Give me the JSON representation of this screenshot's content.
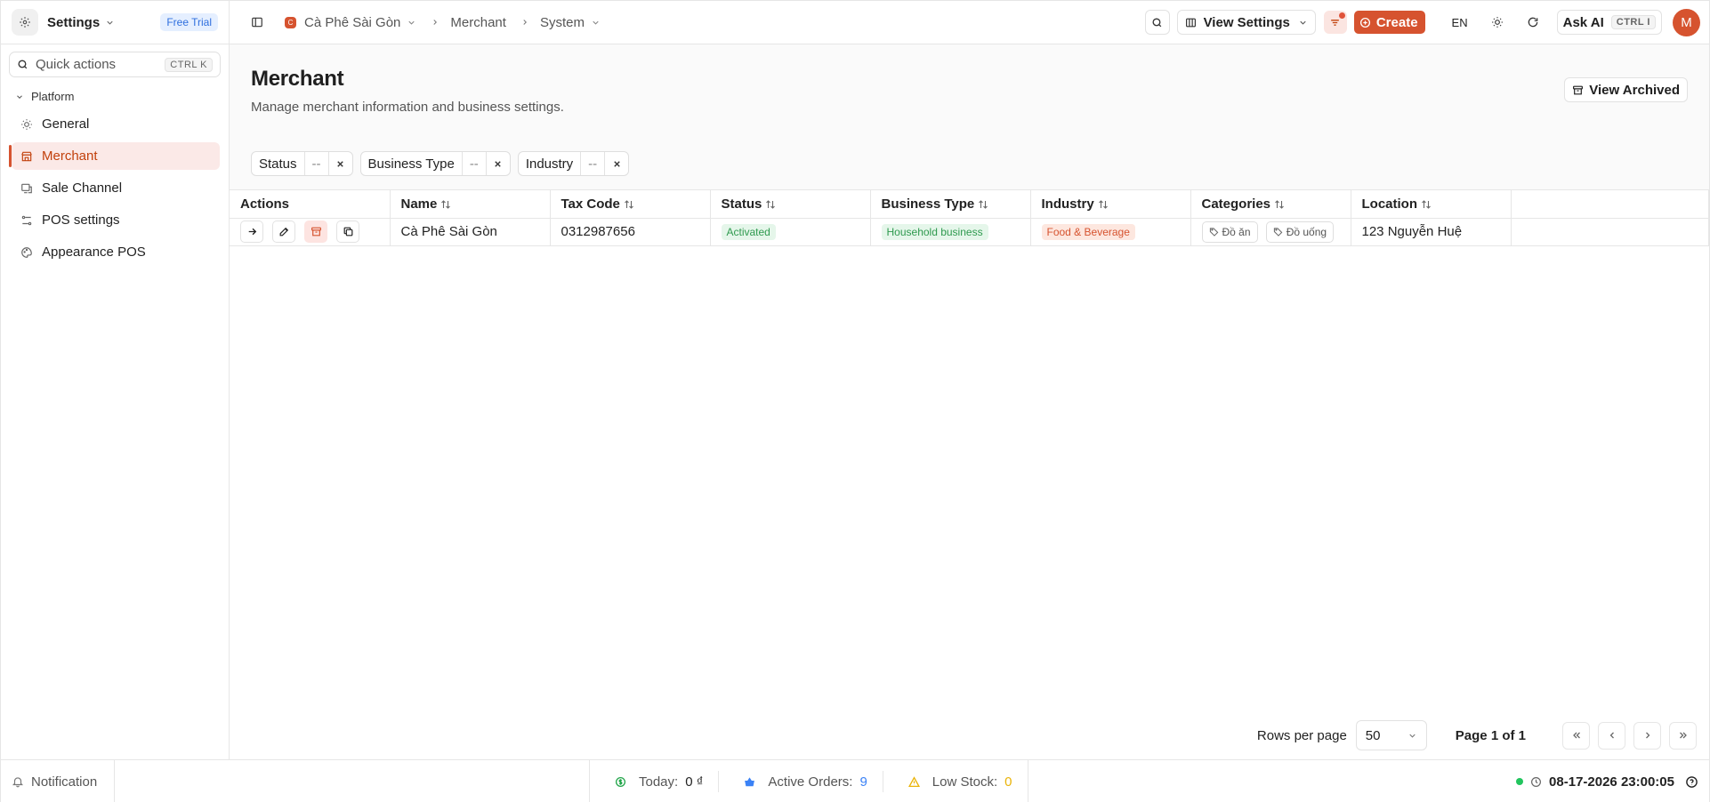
{
  "sidebar": {
    "app_name": "Settings",
    "badge": "Free Trial",
    "quick_actions": {
      "label": "Quick actions",
      "shortcut": "CTRL K"
    },
    "group": "Platform",
    "items": [
      {
        "label": "General",
        "icon": "sun-icon",
        "active": false
      },
      {
        "label": "Merchant",
        "icon": "store-icon",
        "active": true
      },
      {
        "label": "Sale Channel",
        "icon": "channel-icon",
        "active": false
      },
      {
        "label": "POS settings",
        "icon": "pos-settings-icon",
        "active": false
      },
      {
        "label": "Appearance POS",
        "icon": "palette-icon",
        "active": false
      }
    ]
  },
  "topbar": {
    "breadcrumbs": [
      "Cà Phê Sài Gòn",
      "Merchant",
      "System"
    ],
    "view_settings": "View Settings",
    "create": "Create",
    "language": "EN",
    "ask_ai": {
      "label": "Ask AI",
      "shortcut": "CTRL I"
    },
    "avatar_initial": "M"
  },
  "page": {
    "title": "Merchant",
    "description": "Manage merchant information and business settings.",
    "view_archived": "View Archived",
    "filters": [
      {
        "label": "Status",
        "value": "--"
      },
      {
        "label": "Business Type",
        "value": "--"
      },
      {
        "label": "Industry",
        "value": "--"
      }
    ]
  },
  "table": {
    "columns": [
      "Actions",
      "Name",
      "Tax Code",
      "Status",
      "Business Type",
      "Industry",
      "Categories",
      "Location"
    ],
    "rows": [
      {
        "name": "Cà Phê Sài Gòn",
        "tax_code": "0312987656",
        "status": "Activated",
        "business_type": "Household business",
        "industry": "Food & Beverage",
        "categories": [
          "Đồ ăn",
          "Đồ uống"
        ],
        "location": "123 Nguyễn Huệ"
      }
    ]
  },
  "pagination": {
    "rows_per_page_label": "Rows per page",
    "rows_per_page": "50",
    "page_info": "Page 1 of 1"
  },
  "statusbar": {
    "notification": "Notification",
    "today": {
      "label": "Today:",
      "value": "0 ₫"
    },
    "active_orders": {
      "label": "Active Orders:",
      "value": "9"
    },
    "low_stock": {
      "label": "Low Stock:",
      "value": "0"
    },
    "datetime": "08-17-2026 23:00:05"
  },
  "colors": {
    "accent": "#d6532f",
    "active_bg": "#fbe9e7",
    "trial_badge": "#2f6fde",
    "status_green": "#2f9a4f",
    "orders_blue": "#3b82f6",
    "low_stock_yellow": "#eab308"
  }
}
